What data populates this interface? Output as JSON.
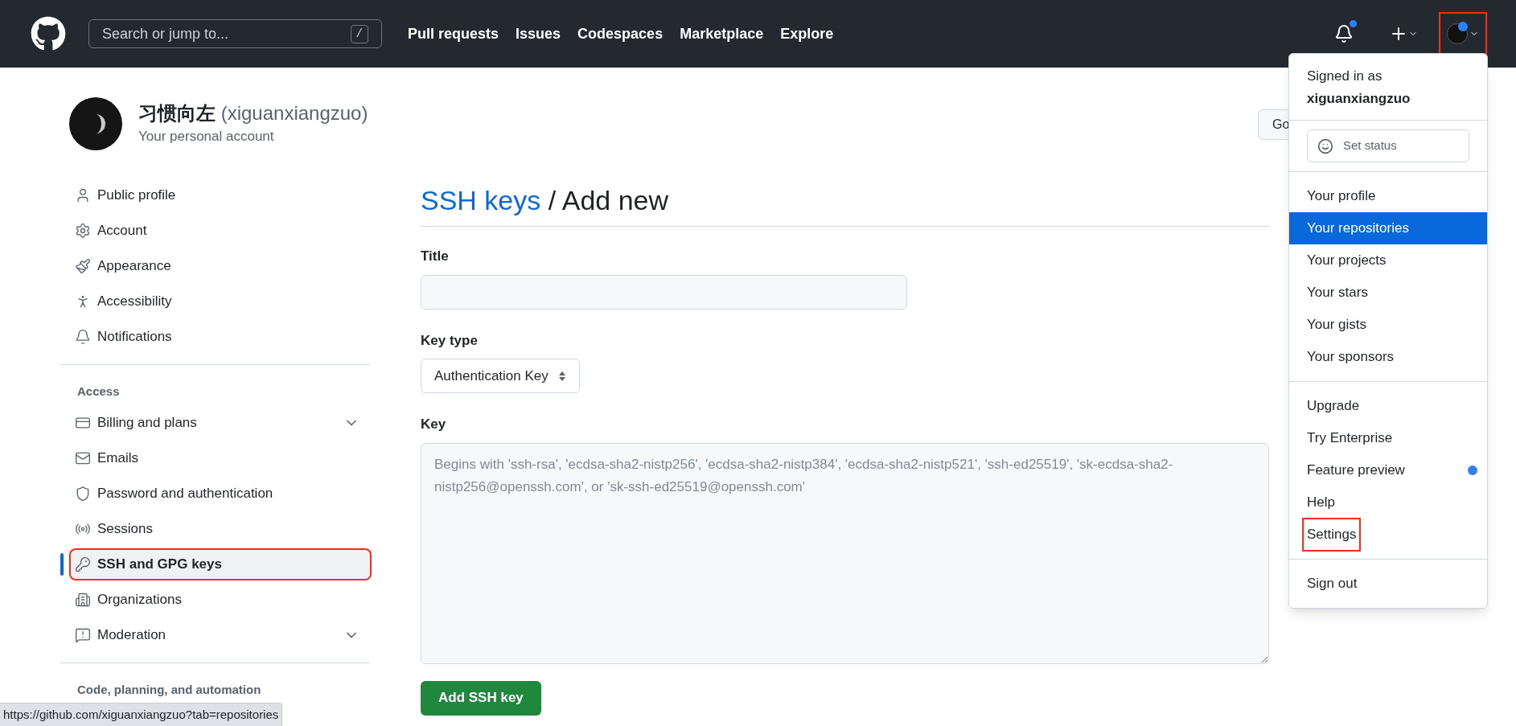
{
  "header": {
    "search": {
      "placeholder": "Search or jump to...",
      "shortcut": "/"
    },
    "nav": [
      "Pull requests",
      "Issues",
      "Codespaces",
      "Marketplace",
      "Explore"
    ],
    "notifications_unread": true,
    "avatar_highlighted": true
  },
  "account": {
    "name": "习惯向左",
    "handle": "(xiguanxiangzuo)",
    "subtitle": "Your personal account",
    "button": "Go"
  },
  "sidebar": {
    "items": [
      {
        "label": "Public profile",
        "selected": false,
        "expandable": false,
        "highlighted": false
      },
      {
        "label": "Account",
        "selected": false,
        "expandable": false,
        "highlighted": false
      },
      {
        "label": "Appearance",
        "selected": false,
        "expandable": false,
        "highlighted": false
      },
      {
        "label": "Accessibility",
        "selected": false,
        "expandable": false,
        "highlighted": false
      },
      {
        "label": "Notifications",
        "selected": false,
        "expandable": false,
        "highlighted": false
      }
    ],
    "sections": [
      {
        "heading": "Access",
        "items": [
          {
            "label": "Billing and plans",
            "selected": false,
            "expandable": true,
            "highlighted": false
          },
          {
            "label": "Emails",
            "selected": false,
            "expandable": false,
            "highlighted": false
          },
          {
            "label": "Password and authentication",
            "selected": false,
            "expandable": false,
            "highlighted": false
          },
          {
            "label": "Sessions",
            "selected": false,
            "expandable": false,
            "highlighted": false
          },
          {
            "label": "SSH and GPG keys",
            "selected": true,
            "expandable": false,
            "highlighted": true
          },
          {
            "label": "Organizations",
            "selected": false,
            "expandable": false,
            "highlighted": false
          },
          {
            "label": "Moderation",
            "selected": false,
            "expandable": true,
            "highlighted": false
          }
        ]
      },
      {
        "heading": "Code, planning, and automation"
      }
    ]
  },
  "page": {
    "breadcrumb_link": "SSH keys",
    "breadcrumb_rest": "/ Add new",
    "fields": [
      {
        "kind": "text",
        "label": "Title"
      },
      {
        "kind": "select",
        "label": "Key type",
        "value": "Authentication Key"
      },
      {
        "kind": "textarea",
        "label": "Key",
        "placeholder": "Begins with 'ssh-rsa', 'ecdsa-sha2-nistp256', 'ecdsa-sha2-nistp384', 'ecdsa-sha2-nistp521', 'ssh-ed25519', 'sk-ecdsa-sha2-nistp256@openssh.com', or 'sk-ssh-ed25519@openssh.com'"
      }
    ],
    "submit": "Add SSH key"
  },
  "menu": {
    "signed_in_label": "Signed in as",
    "username": "xiguanxiangzuo",
    "status_button": "Set status",
    "groups": [
      [
        {
          "label": "Your profile",
          "selected": false,
          "dot": false,
          "highlighted": false
        },
        {
          "label": "Your repositories",
          "selected": true,
          "dot": false,
          "highlighted": false
        },
        {
          "label": "Your projects",
          "selected": false,
          "dot": false,
          "highlighted": false
        },
        {
          "label": "Your stars",
          "selected": false,
          "dot": false,
          "highlighted": false
        },
        {
          "label": "Your gists",
          "selected": false,
          "dot": false,
          "highlighted": false
        },
        {
          "label": "Your sponsors",
          "selected": false,
          "dot": false,
          "highlighted": false
        }
      ],
      [
        {
          "label": "Upgrade",
          "selected": false,
          "dot": false,
          "highlighted": false
        },
        {
          "label": "Try Enterprise",
          "selected": false,
          "dot": false,
          "highlighted": false
        },
        {
          "label": "Feature preview",
          "selected": false,
          "dot": true,
          "highlighted": false
        },
        {
          "label": "Help",
          "selected": false,
          "dot": false,
          "highlighted": false
        },
        {
          "label": "Settings",
          "selected": false,
          "dot": false,
          "highlighted": true
        }
      ]
    ],
    "sign_out": "Sign out"
  },
  "status_bar": {
    "url": "https://github.com/xiguanxiangzuo?tab=repositories"
  }
}
